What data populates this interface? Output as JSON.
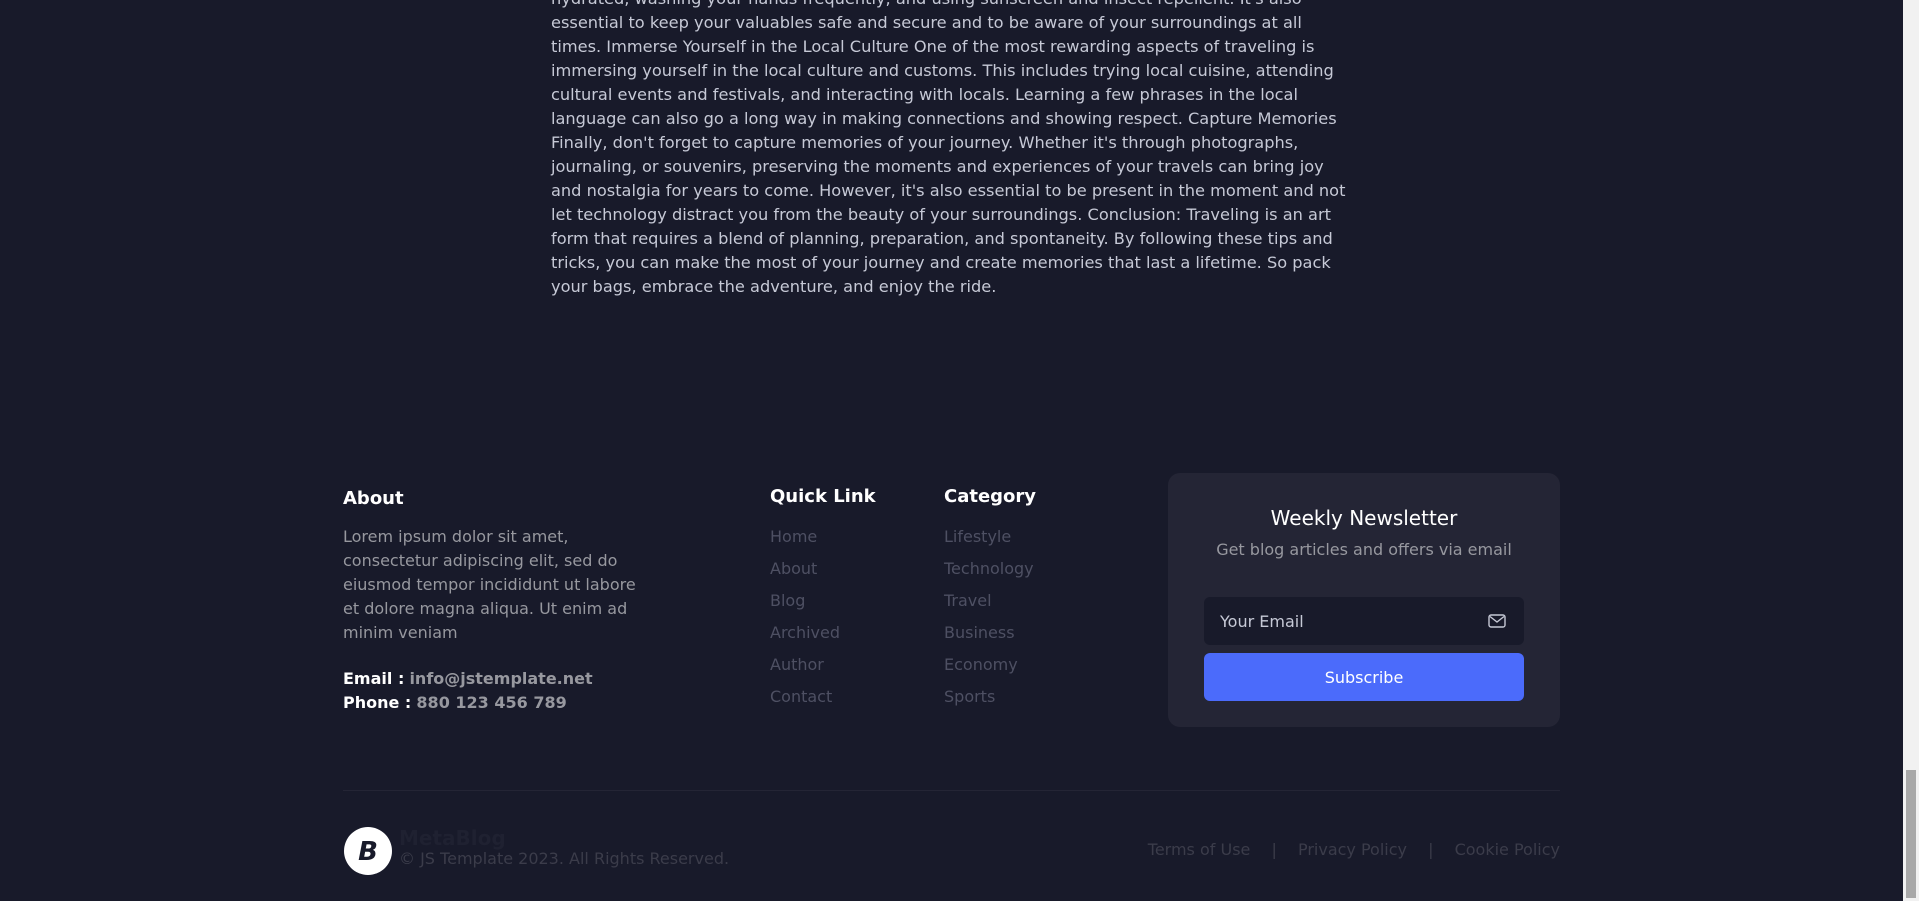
{
  "article": {
    "text": "hydrated, washing your hands frequently, and using sunscreen and insect repellent. It's also essential to keep your valuables safe and secure and to be aware of your surroundings at all times. Immerse Yourself in the Local Culture One of the most rewarding aspects of traveling is immersing yourself in the local culture and customs. This includes trying local cuisine, attending cultural events and festivals, and interacting with locals. Learning a few phrases in the local language can also go a long way in making connections and showing respect. Capture Memories Finally, don't forget to capture memories of your journey. Whether it's through photographs, journaling, or souvenirs, preserving the moments and experiences of your travels can bring joy and nostalgia for years to come. However, it's also essential to be present in the moment and not let technology distract you from the beauty of your surroundings. Conclusion: Traveling is an art form that requires a blend of planning, preparation, and spontaneity. By following these tips and tricks, you can make the most of your journey and create memories that last a lifetime. So pack your bags, embrace the adventure, and enjoy the ride."
  },
  "footer": {
    "about": {
      "title": "About",
      "text": "Lorem ipsum dolor sit amet, consectetur adipiscing elit, sed do eiusmod tempor incididunt ut labore et dolore magna aliqua. Ut enim ad minim veniam",
      "email_label": "Email :",
      "email": "info@jstemplate.net",
      "phone_label": "Phone :",
      "phone": "880 123 456 789"
    },
    "quick_link": {
      "title": "Quick Link",
      "items": [
        "Home",
        "About",
        "Blog",
        "Archived",
        "Author",
        "Contact"
      ]
    },
    "category": {
      "title": "Category",
      "items": [
        "Lifestyle",
        "Technology",
        "Travel",
        "Business",
        "Economy",
        "Sports"
      ]
    },
    "newsletter": {
      "title": "Weekly Newsletter",
      "subtitle": "Get blog articles and offers via email",
      "email_placeholder": "Your Email",
      "button": "Subscribe"
    }
  },
  "bottom": {
    "brand": "MetaBlog",
    "copyright": "© JS Template 2023. All Rights Reserved.",
    "legal": [
      "Terms of Use",
      "Privacy Policy",
      "Cookie Policy"
    ],
    "separator": "|"
  },
  "colors": {
    "background": "#181a2a",
    "card": "#242535",
    "accent": "#4b6bfb",
    "muted_text": "#97989f",
    "dim_link": "#4e5063"
  },
  "icons": [
    "mail-icon",
    "logo-icon"
  ]
}
